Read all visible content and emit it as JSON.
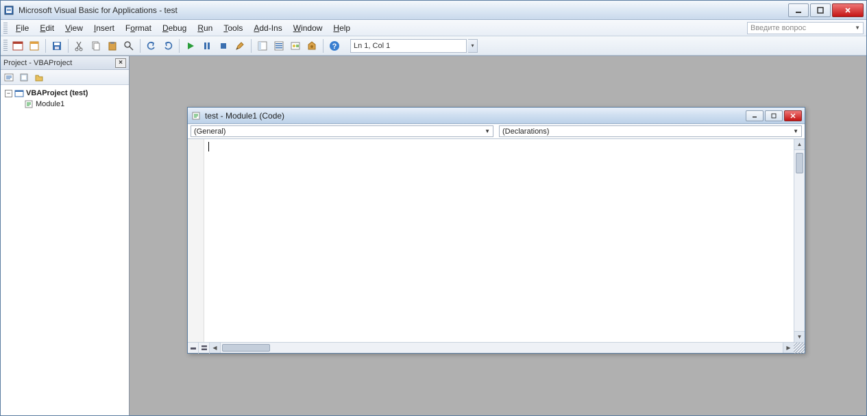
{
  "title": "Microsoft Visual Basic for Applications - test",
  "menu": {
    "file": "File",
    "edit": "Edit",
    "view": "View",
    "insert": "Insert",
    "format": "Format",
    "debug": "Debug",
    "run": "Run",
    "tools": "Tools",
    "addins": "Add-Ins",
    "window": "Window",
    "help": "Help"
  },
  "ask_box_placeholder": "Введите вопрос",
  "toolbar": {
    "position": "Ln 1, Col 1"
  },
  "project_panel": {
    "title": "Project - VBAProject",
    "root": "VBAProject (test)",
    "module": "Module1"
  },
  "code_window": {
    "title": "test - Module1 (Code)",
    "object_dd": "(General)",
    "proc_dd": "(Declarations)"
  }
}
